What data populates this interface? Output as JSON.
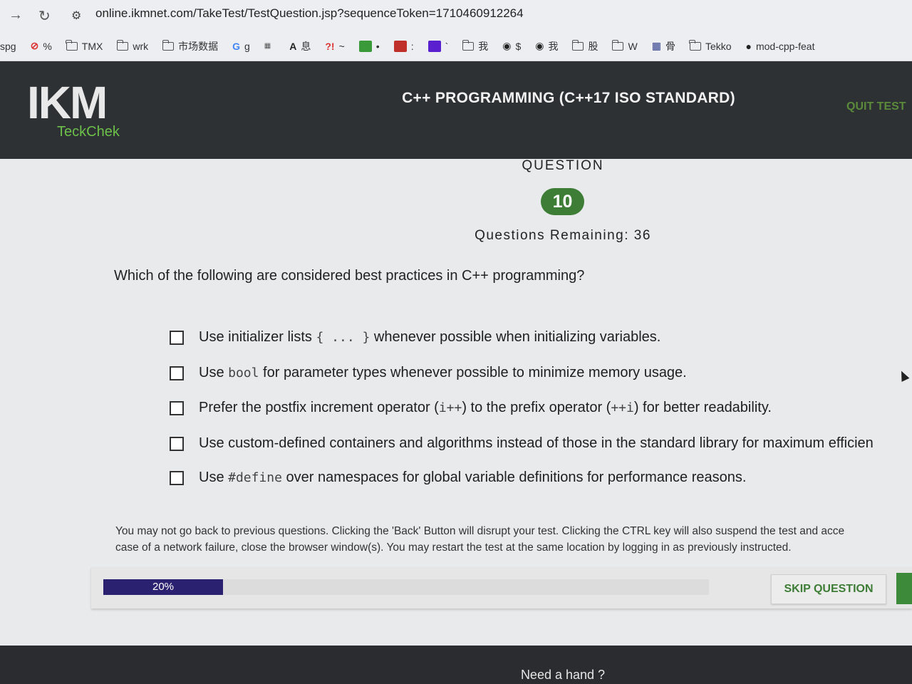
{
  "browser": {
    "url": "online.ikmnet.com/TakeTest/TestQuestion.jsp?sequenceToken=1710460912264",
    "bookmarks": [
      {
        "label": "spg",
        "icon": "none"
      },
      {
        "label": "%",
        "icon": "blocked-icon"
      },
      {
        "label": "TMX",
        "icon": "folder-icon"
      },
      {
        "label": "wrk",
        "icon": "folder-icon"
      },
      {
        "label": "市场数据",
        "icon": "folder-icon"
      },
      {
        "label": "g",
        "icon": "google-icon"
      },
      {
        "label": "",
        "icon": "site-icon"
      },
      {
        "label": "息",
        "icon": "site-icon"
      },
      {
        "label": "~",
        "icon": "exclaim-icon"
      },
      {
        "label": "•",
        "icon": "tc-icon"
      },
      {
        "label": ":",
        "icon": "red-icon"
      },
      {
        "label": "`",
        "icon": "yahoo-icon"
      },
      {
        "label": "我",
        "icon": "folder-icon"
      },
      {
        "label": "$",
        "icon": "globe-icon"
      },
      {
        "label": "我",
        "icon": "globe-icon"
      },
      {
        "label": "股",
        "icon": "folder-icon"
      },
      {
        "label": "W",
        "icon": "folder-icon"
      },
      {
        "label": "骨",
        "icon": "grid-icon"
      },
      {
        "label": "Tekko",
        "icon": "folder-icon"
      },
      {
        "label": "mod-cpp-feat",
        "icon": "github-icon"
      }
    ]
  },
  "header": {
    "logo": "IKM",
    "logo_sub": "TeckChek",
    "test_title": "C++ PROGRAMMING (C++17 ISO STANDARD)",
    "quit_label": "QUIT TEST"
  },
  "question": {
    "label": "QUESTION",
    "number": "10",
    "remaining": "Questions Remaining: 36",
    "text": "Which of the following are considered best practices in C++ programming?",
    "options": [
      {
        "pre": "Use initializer lists ",
        "code": "{ ... }",
        "post": " whenever possible when initializing variables."
      },
      {
        "pre": "Use ",
        "code": "bool",
        "post": " for parameter types whenever possible to minimize memory usage."
      },
      {
        "pre": "Prefer the postfix increment operator (",
        "code": "i++",
        "post": ") to the prefix operator (",
        "code2": "++i",
        "post2": ") for better readability."
      },
      {
        "pre": "Use custom-defined containers and algorithms instead of those in the standard library for maximum efficien",
        "code": "",
        "post": ""
      },
      {
        "pre": "Use ",
        "code": "#define",
        "post": " over namespaces for global variable definitions for performance reasons."
      }
    ]
  },
  "notice": {
    "line1": "You may not go back to previous questions. Clicking the 'Back' Button will disrupt your test. Clicking the CTRL key will also suspend the test and acce",
    "line2": "case of a network failure, close the browser window(s). You may restart the test at the same location by logging in as previously instructed."
  },
  "progress": {
    "label": "20%",
    "fraction": 0.2
  },
  "buttons": {
    "skip": "SKIP QUESTION"
  },
  "footer": {
    "help": "Need a hand ?"
  },
  "colors": {
    "header_bg": "#2e3134",
    "brand_green": "#3d7d36",
    "progress_fill": "#2a2270"
  }
}
